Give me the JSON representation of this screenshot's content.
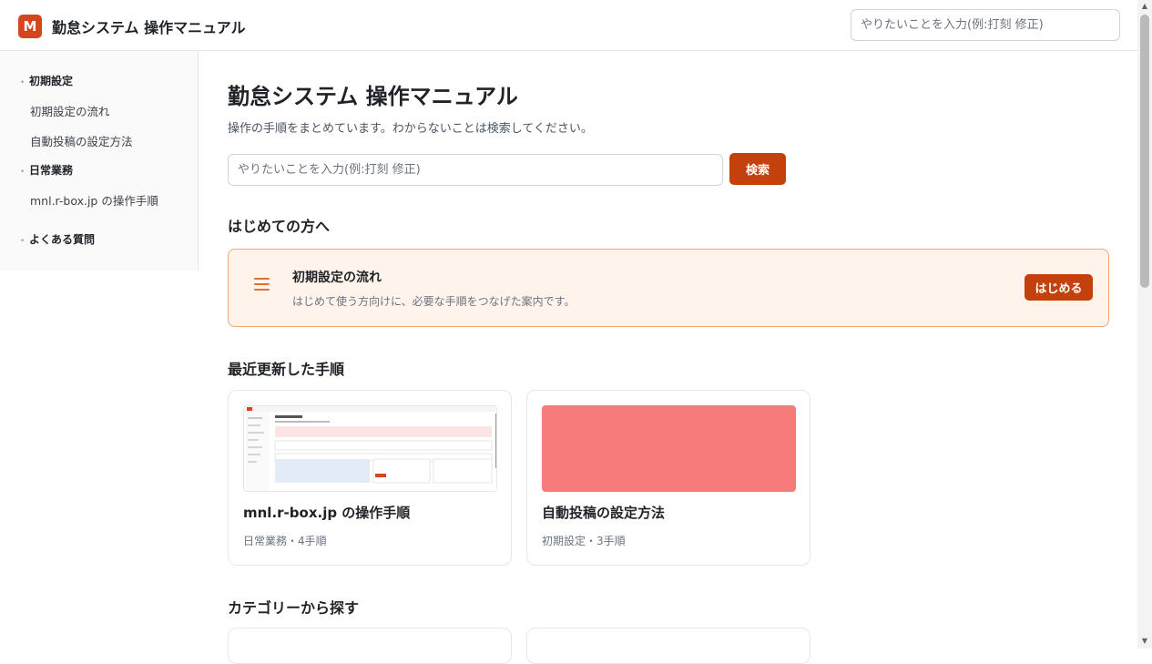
{
  "header": {
    "logo_letter": "M",
    "title": "勤怠システム 操作マニュアル",
    "search_placeholder": "やりたいことを入力(例:打刻 修正)"
  },
  "sidebar": {
    "sections": [
      {
        "label": "初期設定",
        "items": [
          "初期設定の流れ",
          "自動投稿の設定方法"
        ]
      },
      {
        "label": "日常業務",
        "items": [
          "mnl.r-box.jp の操作手順"
        ]
      },
      {
        "label": "よくある質問",
        "items": []
      }
    ]
  },
  "main": {
    "title": "勤怠システム 操作マニュアル",
    "subtitle": "操作の手順をまとめています。わからないことは検索してください。",
    "search_placeholder": "やりたいことを入力(例:打刻 修正)",
    "search_button": "検索",
    "first_time_heading": "はじめての方へ",
    "onboarding": {
      "title": "初期設定の流れ",
      "description": "はじめて使う方向けに、必要な手順をつなげた案内です。",
      "button": "はじめる"
    },
    "recent_heading": "最近更新した手順",
    "recent_cards": [
      {
        "title": "mnl.r-box.jp の操作手順",
        "meta": "日常業務・4手順",
        "thumb": "screenshot"
      },
      {
        "title": "自動投稿の設定方法",
        "meta": "初期設定・3手順",
        "thumb": "pink-placeholder"
      }
    ],
    "category_heading": "カテゴリーから探す"
  },
  "colors": {
    "accent": "#c2410c",
    "logo": "#d4461d",
    "onboard_bg": "#fff4ec",
    "onboard_border": "#f1a673",
    "thumb_pink": "#f87b7b"
  }
}
